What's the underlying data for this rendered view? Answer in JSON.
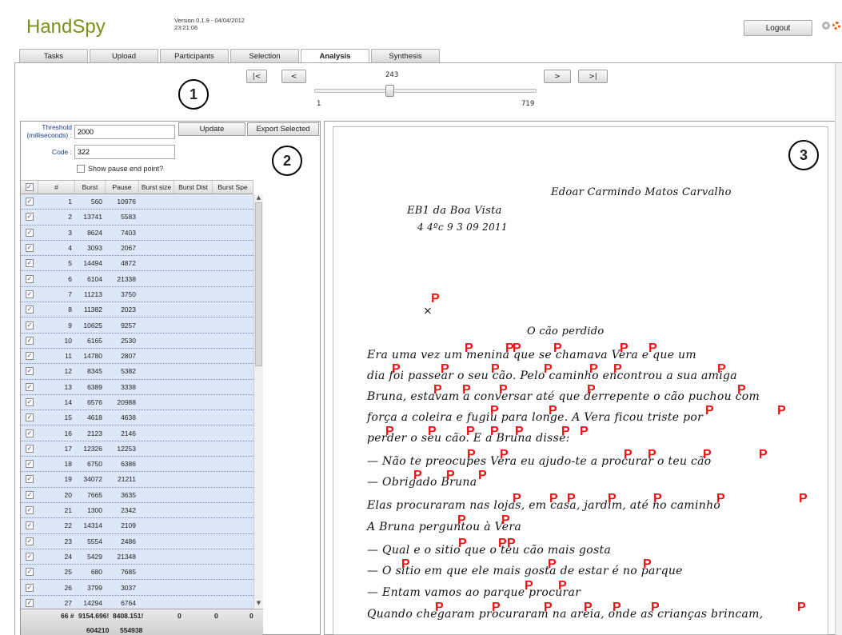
{
  "app": {
    "title": "HandSpy",
    "version_line1": "Version 0.1.9 - 04/04/2012",
    "version_line2": "23:21:06",
    "logout_label": "Logout"
  },
  "tabs": [
    {
      "label": "Tasks",
      "active": false
    },
    {
      "label": "Upload",
      "active": false
    },
    {
      "label": "Participants",
      "active": false
    },
    {
      "label": "Selection",
      "active": false
    },
    {
      "label": "Analysis",
      "active": true
    },
    {
      "label": "Synthesis",
      "active": false
    }
  ],
  "navigator": {
    "first": "|<",
    "prev": "<",
    "next": ">",
    "last": ">|",
    "current": "243",
    "min": "1",
    "max": "719"
  },
  "callouts": {
    "one": "1",
    "two": "2",
    "three": "3"
  },
  "form": {
    "threshold_label": "Threshold (milliseconds) :",
    "threshold_value": "2000",
    "code_label": "Code :",
    "code_value": "322",
    "update_label": "Update",
    "export_label": "Export Selected",
    "show_pause_label": "Show pause end point?"
  },
  "table": {
    "headers": [
      "#",
      "Burst",
      "Pause",
      "Burst size",
      "Burst Dist",
      "Burst Spe"
    ],
    "rows": [
      [
        "1",
        "560",
        "10976"
      ],
      [
        "2",
        "13741",
        "5583"
      ],
      [
        "3",
        "8624",
        "7403"
      ],
      [
        "4",
        "3093",
        "2067"
      ],
      [
        "5",
        "14494",
        "4872"
      ],
      [
        "6",
        "6104",
        "21338"
      ],
      [
        "7",
        "11213",
        "3750"
      ],
      [
        "8",
        "11382",
        "2023"
      ],
      [
        "9",
        "10625",
        "9257"
      ],
      [
        "10",
        "6165",
        "2530"
      ],
      [
        "11",
        "14780",
        "2807"
      ],
      [
        "12",
        "8345",
        "5382"
      ],
      [
        "13",
        "6389",
        "3338"
      ],
      [
        "14",
        "6576",
        "20988"
      ],
      [
        "15",
        "4618",
        "4638"
      ],
      [
        "16",
        "2123",
        "2146"
      ],
      [
        "17",
        "12326",
        "12253"
      ],
      [
        "18",
        "6750",
        "6386"
      ],
      [
        "19",
        "34072",
        "21211"
      ],
      [
        "20",
        "7665",
        "3635"
      ],
      [
        "21",
        "1300",
        "2342"
      ],
      [
        "22",
        "14314",
        "2109"
      ],
      [
        "23",
        "5554",
        "2486"
      ],
      [
        "24",
        "5429",
        "21348"
      ],
      [
        "25",
        "680",
        "7685"
      ],
      [
        "26",
        "3799",
        "3037"
      ],
      [
        "27",
        "14294",
        "6764"
      ]
    ],
    "footer": {
      "count": "66 #",
      "burst_avg": "9154.696!",
      "pause_avg": "8408.151!",
      "size": "0",
      "dist": "0",
      "speed": "0",
      "burst_sum": "604210",
      "pause_sum": "554938"
    }
  },
  "document": {
    "lines": [
      "Edoar Carmindo Matos Carvalho",
      "EB1 da Boa Vista",
      "4        4ºc          9                                   3  09  2011",
      "O cão perdido",
      "Era uma vez um menina que se chamava Vera e que um",
      "dia foi passear o seu cão. Pelo caminho encontrou a sua amiga",
      "Bruna, estavam a conversar até que derrepente o cão puchou com",
      "força a coleira e fugiu para longe. A Vera ficou triste por",
      "perder o seu cão. E a Bruna disse:",
      "— Não te preocupes Vera eu ajudo-te a procurar o teu cão",
      "— Obrigado Bruna",
      "Elas procuraram nas lojas, em casa, jardim, até no caminho",
      "A Bruna perguntou à Vera",
      "— Qual e o sitio que o teu cão mais gosta",
      "— O sitio em que ele mais gosta de estar é no parque",
      "— Entam vamos ao parque procurar",
      "Quando chegaram procuraram na areia, onde as crianças brincam,"
    ],
    "pause_marker": "P"
  },
  "colors": {
    "brand": "#7d8e1b",
    "pause_marker": "#e11111",
    "row_bg": "#dde7f7"
  }
}
